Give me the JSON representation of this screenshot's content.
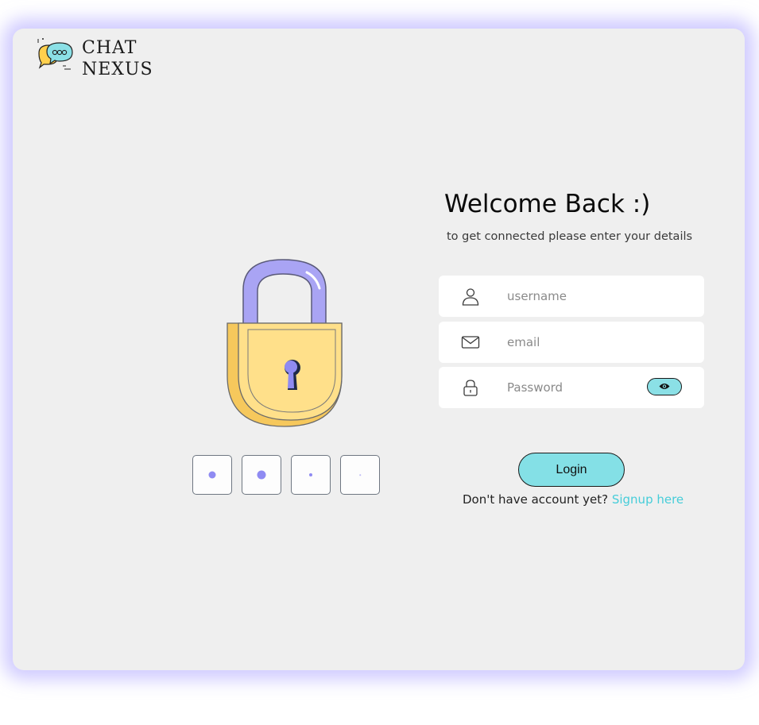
{
  "app": {
    "logo_line1": "CHAT",
    "logo_line2": "NEXUS"
  },
  "colors": {
    "card_background": "#efefef",
    "glow": "#aaa0ff",
    "accent_teal": "#84e0e6",
    "link": "#46cdd9",
    "lock_body": "#ffe08a",
    "lock_shackle": "#a9a4f4"
  },
  "illustration": {
    "icon": "padlock-icon",
    "pin_icon": "pin-dot-icon"
  },
  "form": {
    "title": "Welcome Back :)",
    "subtitle": "to get connected please enter your details",
    "username_placeholder": "username",
    "email_placeholder": "email",
    "password_placeholder": "Password",
    "username_icon": "user-icon",
    "email_icon": "envelope-icon",
    "password_icon": "lock-icon",
    "toggle_icon": "eye-icon",
    "login_label": "Login",
    "signup_prompt": "Don't have account yet?",
    "signup_link": "Signup here"
  }
}
